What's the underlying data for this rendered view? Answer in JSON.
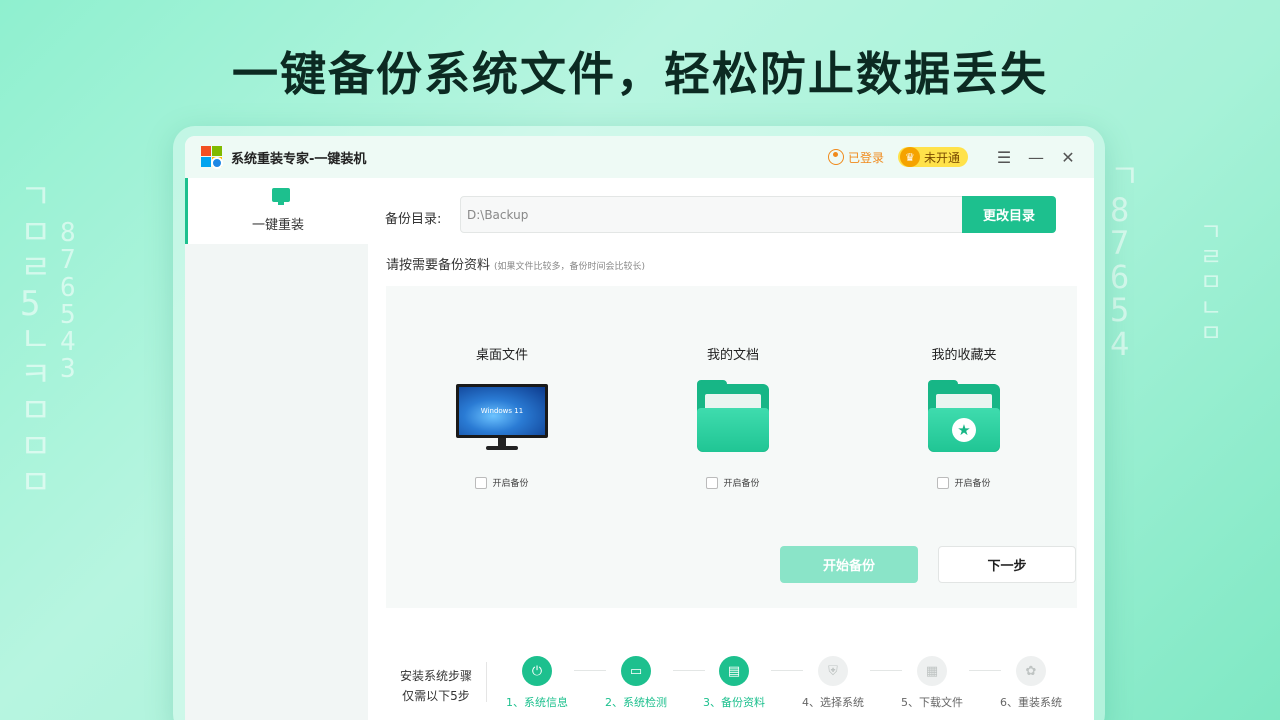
{
  "headline": "一键备份系统文件，轻松防止数据丢失",
  "window": {
    "title": "系统重装专家-一键装机",
    "login_label": "已登录",
    "vip_label": "未开通"
  },
  "sidebar": {
    "items": [
      {
        "label": "一键重装",
        "icon": "monitor-icon",
        "active": true
      }
    ]
  },
  "backup": {
    "dir_label": "备份目录:",
    "dir_value": "D:\\Backup",
    "change_dir_label": "更改目录",
    "select_label": "请按需要备份资料",
    "select_hint": "(如果文件比较多，备份时间会比较长)",
    "cards": [
      {
        "title": "桌面文件",
        "icon": "desktop-monitor-icon",
        "screen_text": "Windows 11",
        "checkbox_label": "开启备份",
        "checked": false
      },
      {
        "title": "我的文档",
        "icon": "folder-icon",
        "checkbox_label": "开启备份",
        "checked": false
      },
      {
        "title": "我的收藏夹",
        "icon": "star-folder-icon",
        "checkbox_label": "开启备份",
        "checked": false
      }
    ],
    "start_label": "开始备份",
    "next_label": "下一步"
  },
  "steps": {
    "label_line1": "安装系统步骤",
    "label_line2": "仅需以下5步",
    "items": [
      {
        "label": "1、系统信息",
        "icon": "power-icon",
        "done": true
      },
      {
        "label": "2、系统检测",
        "icon": "monitor-icon",
        "done": true
      },
      {
        "label": "3、备份资料",
        "icon": "drive-icon",
        "done": true
      },
      {
        "label": "4、选择系统",
        "icon": "shield-icon",
        "done": false
      },
      {
        "label": "5、下载文件",
        "icon": "file-icon",
        "done": false
      },
      {
        "label": "6、重装系统",
        "icon": "grid-icon",
        "done": false
      }
    ]
  },
  "colors": {
    "accent": "#1dc08e",
    "vip": "#ffe24a",
    "login": "#f08a1c"
  }
}
